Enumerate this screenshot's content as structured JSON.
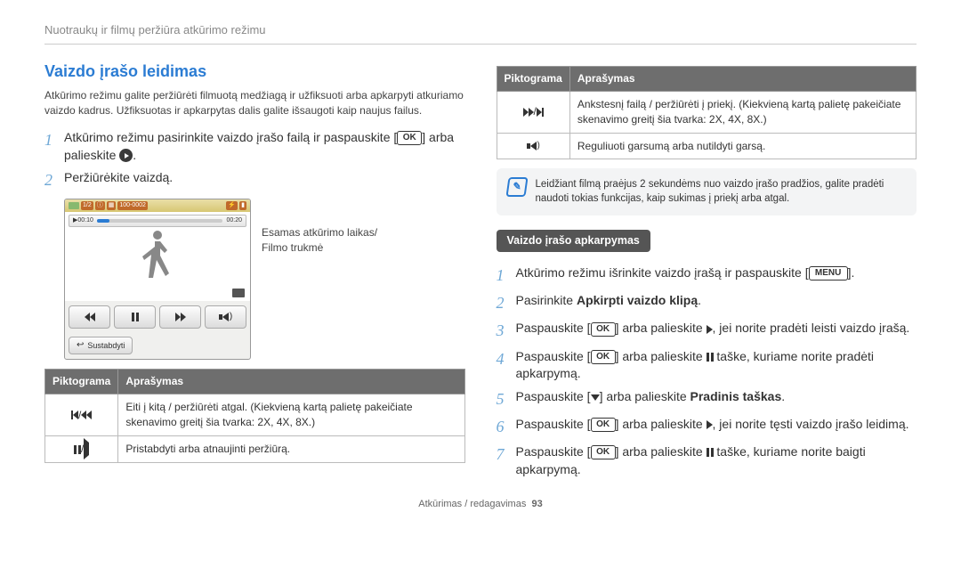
{
  "breadcrumb": "Nuotraukų ir filmų peržiūra atkūrimo režimu",
  "section_title": "Vaizdo įrašo leidimas",
  "intro": "Atkūrimo režimu galite peržiūrėti filmuotą medžiagą ir užfiksuoti arba apkarpyti atkuriamo vaizdo kadrus. Užfiksuotas ir apkarpytas dalis galite išsaugoti kaip naujus failus.",
  "left_steps": {
    "s1a": "Atkūrimo režimu pasirinkite vaizdo įrašo failą ir paspauskite [",
    "s1b": "] arba palieskite ",
    "s1c": ".",
    "s2": "Peržiūrėkite vaizdą."
  },
  "player": {
    "counter": "1/2",
    "time_start": "00:10",
    "time_end": "00:20",
    "stop_label": "Sustabdyti",
    "side_label": "Esamas atkūrimo laikas/\nFilmo trukmė"
  },
  "left_table": {
    "headers": {
      "icon": "Piktograma",
      "desc": "Aprašymas"
    },
    "rows": [
      {
        "desc": "Eiti į kitą / peržiūrėti atgal. (Kiekvieną kartą palietę pakeičiate skenavimo greitį šia tvarka: 2X, 4X, 8X.)"
      },
      {
        "desc": "Pristabdyti arba atnaujinti peržiūrą."
      }
    ]
  },
  "right_table": {
    "headers": {
      "icon": "Piktograma",
      "desc": "Aprašymas"
    },
    "rows": [
      {
        "desc": "Ankstesnį failą / peržiūrėti į priekį. (Kiekvieną kartą palietę pakeičiate skenavimo greitį šia tvarka: 2X, 4X, 8X.)"
      },
      {
        "desc": "Reguliuoti garsumą arba nutildyti garsą."
      }
    ]
  },
  "note": "Leidžiant filmą praėjus 2 sekundėms nuo vaizdo įrašo pradžios, galite pradėti naudoti tokias funkcijas, kaip sukimas į priekį arba atgal.",
  "sub_head": "Vaizdo įrašo apkarpymas",
  "right_steps": {
    "s1a": "Atkūrimo režimu išrinkite vaizdo įrašą ir paspauskite [",
    "s1b": "].",
    "s2a": "Pasirinkite ",
    "s2b": "Apkirpti vaizdo klipą",
    "s2c": ".",
    "s3a": "Paspauskite [",
    "s3b": "] arba palieskite ",
    "s3c": ", jei norite pradėti leisti vaizdo įrašą.",
    "s4a": "Paspauskite [",
    "s4b": "] arba palieskite ",
    "s4c": " taške, kuriame norite pradėti apkarpymą.",
    "s5a": "Paspauskite [",
    "s5b": "] arba palieskite ",
    "s5c": "Pradinis taškas",
    "s5d": ".",
    "s6a": "Paspauskite [",
    "s6b": "] arba palieskite ",
    "s6c": ", jei norite tęsti vaizdo įrašo leidimą.",
    "s7a": "Paspauskite [",
    "s7b": "] arba palieskite ",
    "s7c": " taške, kuriame norite baigti apkarpymą."
  },
  "key_labels": {
    "ok": "OK",
    "menu": "MENU"
  },
  "footer": {
    "section": "Atkūrimas / redagavimas",
    "page": "93"
  }
}
